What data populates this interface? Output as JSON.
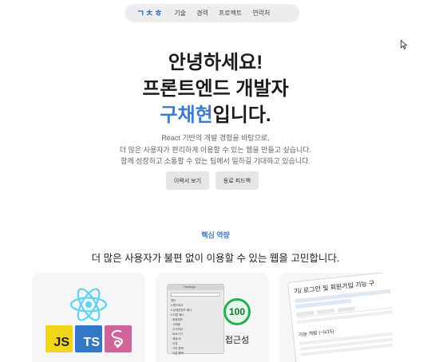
{
  "nav": {
    "logo": "ㄱㅊㅎ",
    "items": [
      "기술",
      "경력",
      "프로젝트",
      "연락처"
    ]
  },
  "hero": {
    "line1": "안녕하세요!",
    "line2": "프론트엔드 개발자",
    "name": "구채현",
    "line3_suffix": "입니다.",
    "desc1": "React 기반의 개발 경험을 바탕으로,",
    "desc2": "더 많은 사용자가 편리하게 이용할 수 있는 웹을 만들고 싶습니다.",
    "desc3": "함께 성장하고 소통할 수 있는 팀에서 일하길 기대하고 있습니다.",
    "resume_button": "이력서 보기",
    "review_button": "동료 피드백"
  },
  "core": {
    "eyebrow": "핵심 역량",
    "title": "더 많은 사용자가 불편 없이 이용할 수 있는 웹을 고민합니다.",
    "card1": {
      "badges": [
        "JS",
        "TS"
      ],
      "icons": [
        "react-icon",
        "javascript-icon",
        "typescript-icon",
        "sass-icon"
      ]
    },
    "card2": {
      "devtools_header": "Headings",
      "devtools_rows": [
        "헤더",
        "▾ 랜드마크",
        "▾ 상세콘텐츠 배너",
        "▾ 다룬 배너",
        "· 회원정보",
        "· 사례별",
        "· 주석처리",
        "· 바로가기",
        "· 제공 ID",
        "· 오류",
        "· 기타 항목",
        "· 다른 항목"
      ],
      "score": "100",
      "score_label": "접근성"
    },
    "card3": {
      "title": "기/ 로그인 및 회원가입 기능 구",
      "column_title": "기능 개발 (~5/15)"
    }
  },
  "colors": {
    "accent": "#3d7bd0",
    "nav_bg": "#ebedf0",
    "score_green": "#23b14d",
    "js": "#f2d619",
    "ts": "#3378c6",
    "sass": "#cf649a"
  }
}
